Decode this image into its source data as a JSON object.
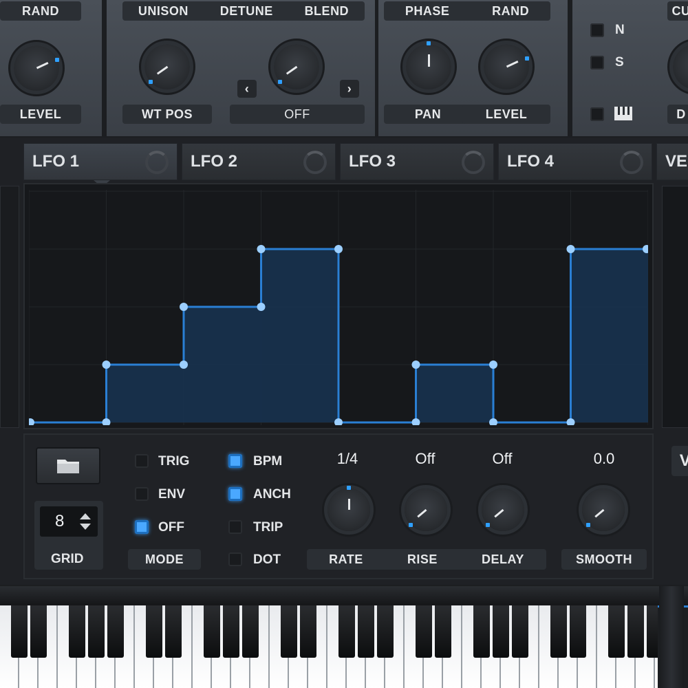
{
  "top": {
    "left_section": {
      "rand": "RAND",
      "level": "LEVEL"
    },
    "unison_section": {
      "unison": "UNISON",
      "detune": "DETUNE",
      "blend": "BLEND",
      "wt_pos": "WT POS",
      "off": "OFF"
    },
    "phase_section": {
      "phase": "PHASE",
      "rand": "RAND",
      "pan": "PAN",
      "level": "LEVEL"
    },
    "right_section": {
      "n": "N",
      "s": "S",
      "cu": "CU",
      "d": "D"
    }
  },
  "tabs": [
    "LFO 1",
    "LFO 2",
    "LFO 3",
    "LFO 4",
    "VE"
  ],
  "lfo_graph": {
    "steps": [
      0,
      0,
      1,
      2,
      3,
      0,
      1,
      0,
      3
    ],
    "max_level": 3,
    "num_steps": 8,
    "colors": {
      "line": "#2a7fd4",
      "fill": "#17324f",
      "point": "#9ccfff",
      "bg": "#16181b"
    }
  },
  "controls": {
    "grid_value": "8",
    "grid_label": "GRID",
    "mode_label": "MODE",
    "trig": "TRIG",
    "env": "ENV",
    "off": "OFF",
    "bpm": "BPM",
    "anch": "ANCH",
    "trip": "TRIP",
    "dot": "DOT",
    "rate_value": "1/4",
    "rise_value": "Off",
    "delay_value": "Off",
    "smooth_value": "0.0",
    "rate": "RATE",
    "rise": "RISE",
    "delay": "DELAY",
    "smooth": "SMOOTH",
    "right_v": "V"
  },
  "checkboxes": {
    "trig": false,
    "env": false,
    "off": true,
    "bpm": true,
    "anch": true,
    "trip": false,
    "dot": false
  }
}
